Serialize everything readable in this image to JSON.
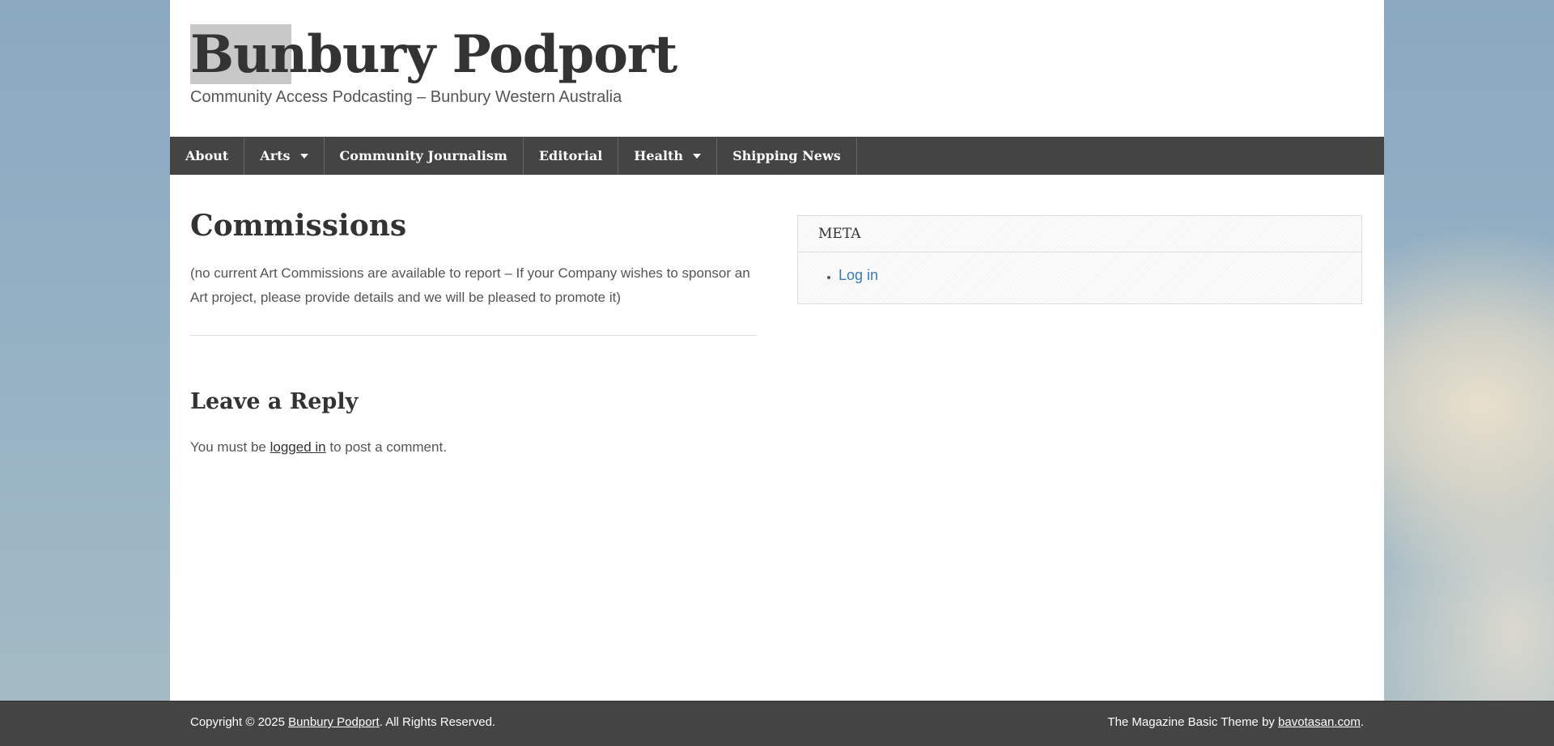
{
  "header": {
    "site_title": "Bunbury Podport",
    "tagline": "Community Access Podcasting – Bunbury Western Australia"
  },
  "nav": {
    "items": [
      {
        "label": "About",
        "has_dropdown": false
      },
      {
        "label": "Arts",
        "has_dropdown": true
      },
      {
        "label": "Community Journalism",
        "has_dropdown": false
      },
      {
        "label": "Editorial",
        "has_dropdown": false
      },
      {
        "label": "Health",
        "has_dropdown": true
      },
      {
        "label": "Shipping News",
        "has_dropdown": false
      }
    ]
  },
  "post": {
    "title": "Commissions",
    "body": "(no current Art Commissions are available to report – If your Company wishes to sponsor an Art project, please provide details and we will be pleased to promote it)"
  },
  "reply": {
    "title": "Leave a Reply",
    "prefix": "You must be ",
    "link_label": "logged in",
    "suffix": " to post a comment."
  },
  "sidebar": {
    "widget_title": "META",
    "links": [
      {
        "label": "Log in"
      }
    ]
  },
  "footer": {
    "copyright_prefix": "Copyright © 2025 ",
    "site_link": "Bunbury Podport",
    "copyright_suffix": ". All Rights Reserved.",
    "theme_prefix": "The Magazine Basic Theme by ",
    "theme_link": "bavotasan.com",
    "theme_suffix": "."
  },
  "colors": {
    "nav_background": "#444444",
    "link": "#3a7bb5",
    "text": "#555555",
    "heading": "#333333"
  },
  "icons": {
    "dropdown": "caret-down-icon",
    "list_bullet": "bullet-icon"
  }
}
